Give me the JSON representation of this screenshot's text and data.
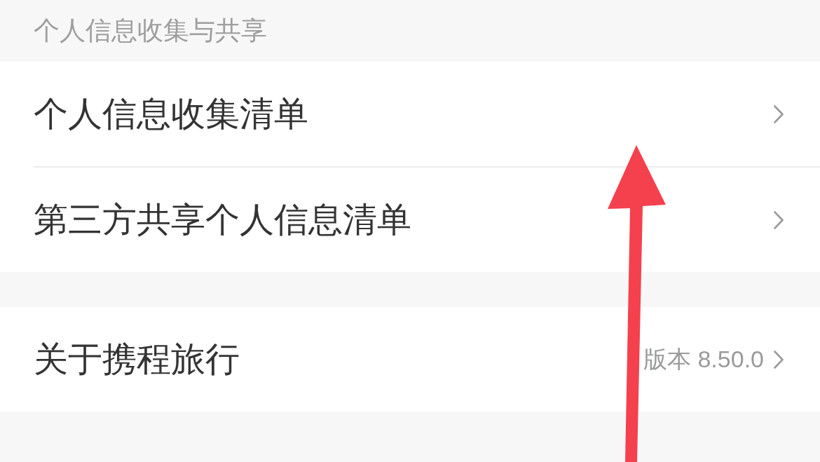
{
  "section_header": "个人信息收集与共享",
  "groups": [
    {
      "rows": [
        {
          "label": "个人信息收集清单"
        },
        {
          "label": "第三方共享个人信息清单"
        }
      ]
    },
    {
      "rows": [
        {
          "label": "关于携程旅行",
          "value": "版本 8.50.0"
        }
      ]
    }
  ],
  "annotations": [
    {
      "kind": "arrow"
    }
  ]
}
